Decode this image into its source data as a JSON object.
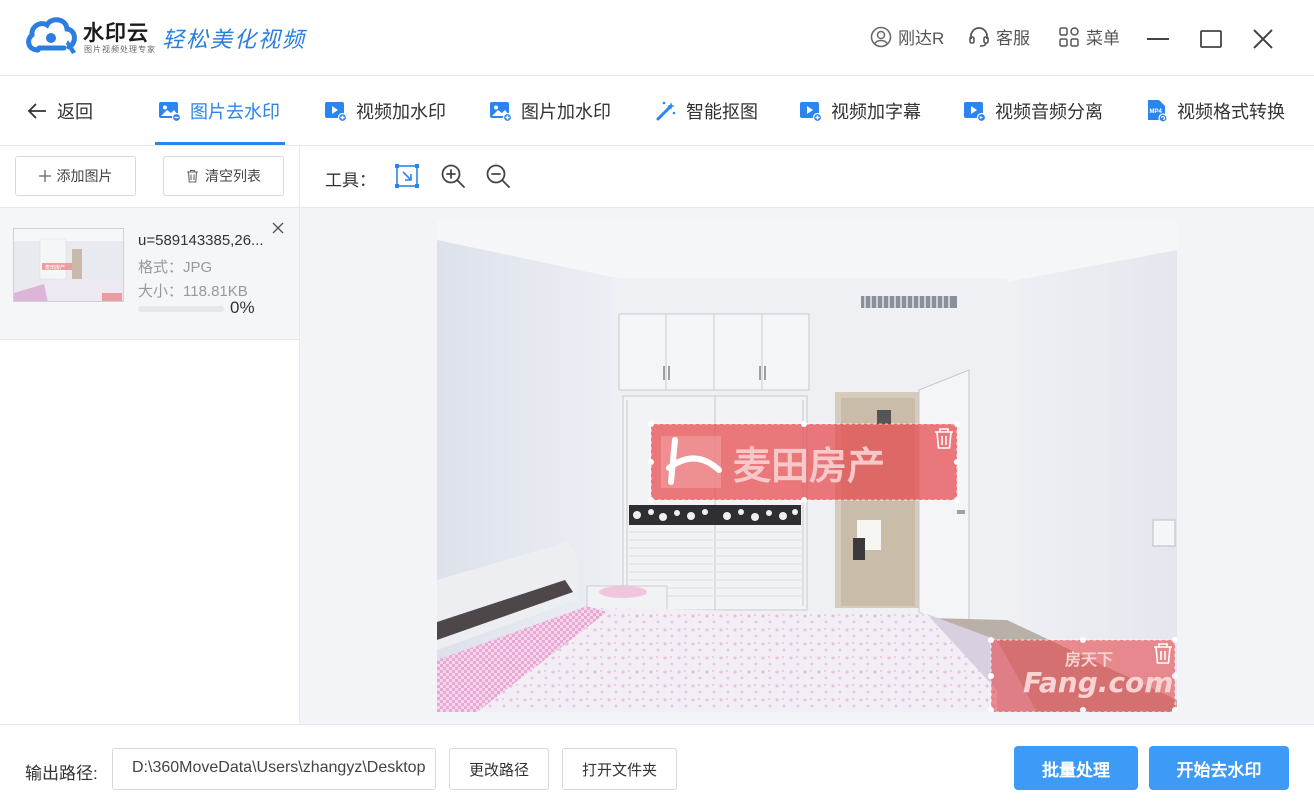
{
  "app": {
    "brand": "水印云",
    "brand_sub": "图片视频处理专家",
    "slogan": "轻松美化视频",
    "user_label": "刚达R",
    "service_label": "客服",
    "menu_label": "菜单"
  },
  "nav": {
    "back_label": "返回",
    "tabs": [
      {
        "label": "图片去水印",
        "active": true
      },
      {
        "label": "视频加水印",
        "active": false
      },
      {
        "label": "图片加水印",
        "active": false
      },
      {
        "label": "智能抠图",
        "active": false
      },
      {
        "label": "视频加字幕",
        "active": false
      },
      {
        "label": "视频音频分离",
        "active": false
      },
      {
        "label": "视频格式转换",
        "active": false
      }
    ]
  },
  "left_panel": {
    "add_label": "添加图片",
    "clear_label": "清空列表",
    "files": [
      {
        "name": "u=589143385,26...",
        "format": "格式：JPG",
        "size": "大小：118.81KB",
        "progress": 0,
        "progress_text": "0%"
      }
    ]
  },
  "toolbar": {
    "label": "工具："
  },
  "watermarks": {
    "primary_text": "麦田房产",
    "secondary_text_top": "房天下",
    "secondary_text": "Fang.com"
  },
  "bottom": {
    "output_label": "输出路径:",
    "output_path": "D:\\360MoveData\\Users\\zhangyz\\Desktop",
    "change_path_label": "更改路径",
    "open_folder_label": "打开文件夹",
    "batch_label": "批量处理",
    "start_label": "开始去水印"
  },
  "colors": {
    "accent": "#2b84f0",
    "primary_button": "#3d9bf7",
    "watermark_overlay": "#e6474b"
  }
}
